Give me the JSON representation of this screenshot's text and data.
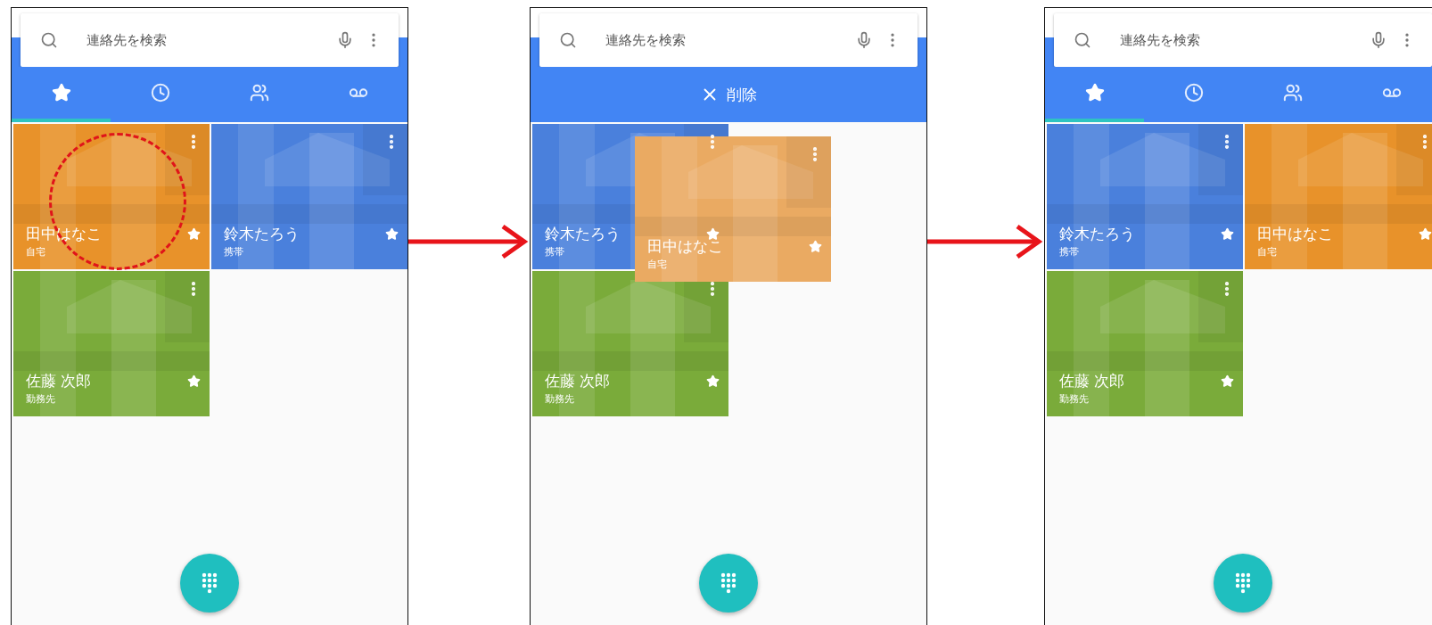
{
  "screens": [
    {
      "search": {
        "placeholder": "連絡先を検索"
      },
      "header": {
        "kind": "tabs",
        "tabs": [
          {
            "selected": true
          },
          {
            "selected": false
          },
          {
            "selected": false
          },
          {
            "selected": false
          }
        ]
      },
      "contacts": [
        {
          "name": "田中はなこ",
          "label": "自宅",
          "color": "#e8922a",
          "starred": true,
          "dragging": false,
          "touched": true
        },
        {
          "name": "鈴木たろう",
          "label": "携帯",
          "color": "#4a80dc",
          "starred": true,
          "dragging": false,
          "touched": false
        },
        {
          "name": "佐藤 次郎",
          "label": "勤務先",
          "color": "#7aab3a",
          "starred": true,
          "dragging": false,
          "touched": false
        }
      ]
    },
    {
      "search": {
        "placeholder": "連絡先を検索"
      },
      "header": {
        "kind": "action",
        "label": "削除"
      },
      "contacts": [
        {
          "name": "鈴木たろう",
          "label": "携帯",
          "color": "#4a80dc",
          "starred": true,
          "dragging": false,
          "touched": false
        },
        {
          "name": "田中はなこ",
          "label": "自宅",
          "color": "#eaaa62",
          "starred": true,
          "dragging": true,
          "touched": false
        },
        {
          "name": "佐藤 次郎",
          "label": "勤務先",
          "color": "#7aab3a",
          "starred": true,
          "dragging": false,
          "touched": false
        }
      ]
    },
    {
      "search": {
        "placeholder": "連絡先を検索"
      },
      "header": {
        "kind": "tabs",
        "tabs": [
          {
            "selected": true
          },
          {
            "selected": false
          },
          {
            "selected": false
          },
          {
            "selected": false
          }
        ]
      },
      "contacts": [
        {
          "name": "鈴木たろう",
          "label": "携帯",
          "color": "#4a80dc",
          "starred": true,
          "dragging": false,
          "touched": false
        },
        {
          "name": "田中はなこ",
          "label": "自宅",
          "color": "#e8922a",
          "starred": true,
          "dragging": false,
          "touched": false
        },
        {
          "name": "佐藤 次郎",
          "label": "勤務先",
          "color": "#7aab3a",
          "starred": true,
          "dragging": false,
          "touched": false
        }
      ]
    }
  ]
}
